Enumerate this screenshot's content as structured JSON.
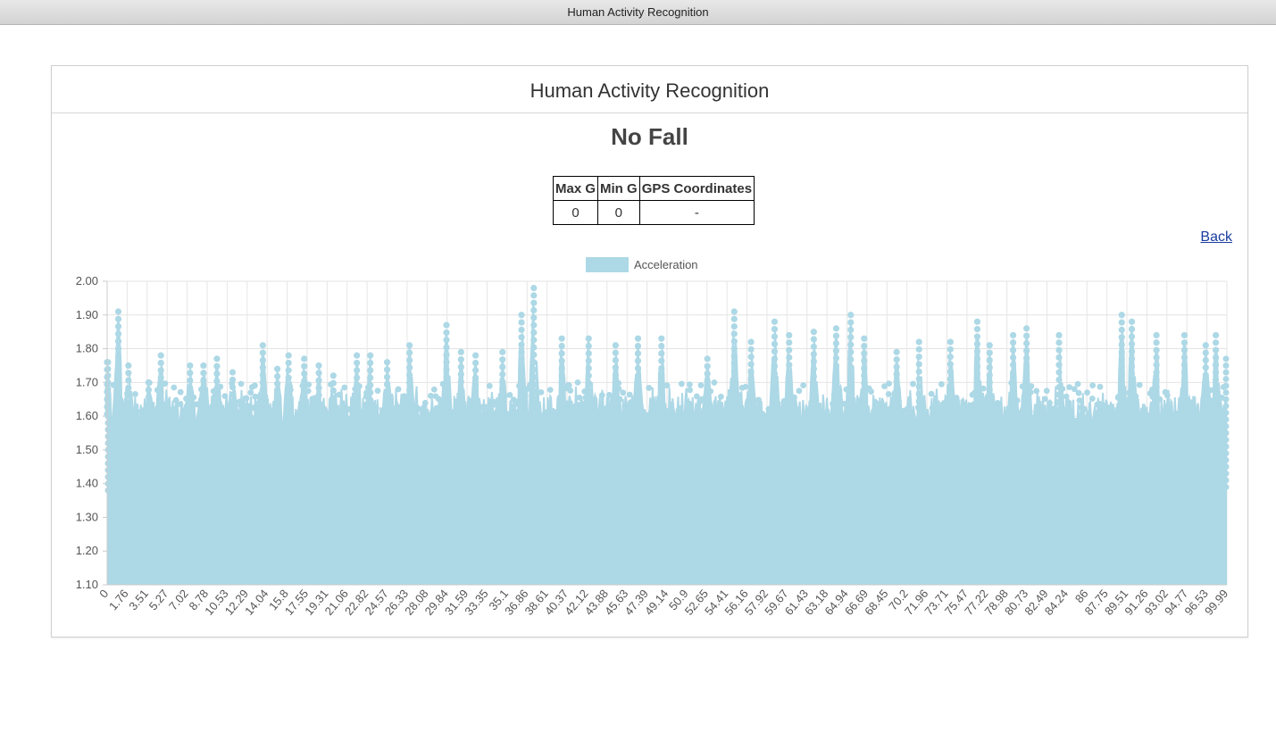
{
  "window": {
    "title": "Human Activity Recognition"
  },
  "card": {
    "title": "Human Activity Recognition"
  },
  "status": "No Fall",
  "stats_table": {
    "headers": [
      "Max G",
      "Min G",
      "GPS Coordinates"
    ],
    "row": [
      "0",
      "0",
      "-"
    ]
  },
  "back_link": "Back",
  "chart_data": {
    "type": "area",
    "series": [
      {
        "name": "Acceleration",
        "color": "#add8e6"
      }
    ],
    "ylim": [
      1.1,
      2.0
    ],
    "y_ticks": [
      "2.00",
      "1.90",
      "1.80",
      "1.70",
      "1.60",
      "1.50",
      "1.40",
      "1.30",
      "1.20",
      "1.10"
    ],
    "x_tick_labels": [
      "0",
      "1.76",
      "3.51",
      "5.27",
      "7.02",
      "8.78",
      "10.53",
      "12.29",
      "14.04",
      "15.8",
      "17.55",
      "19.31",
      "21.06",
      "22.82",
      "24.57",
      "26.33",
      "28.08",
      "29.84",
      "31.59",
      "33.35",
      "35.1",
      "36.86",
      "38.61",
      "40.37",
      "42.12",
      "43.88",
      "45.63",
      "47.39",
      "49.14",
      "50.9",
      "52.65",
      "54.41",
      "56.16",
      "57.92",
      "59.67",
      "61.43",
      "63.18",
      "64.94",
      "66.69",
      "68.45",
      "70.2",
      "71.96",
      "73.71",
      "75.47",
      "77.22",
      "78.98",
      "80.73",
      "82.49",
      "84.24",
      "86",
      "87.75",
      "89.51",
      "91.26",
      "93.02",
      "94.77",
      "96.53",
      "99.99"
    ],
    "x_range": [
      0,
      99.99
    ],
    "grid": true,
    "legend": "top-center",
    "notes_peaks": [
      {
        "x": 0.0,
        "y": 1.76
      },
      {
        "x": 1.0,
        "y": 1.91
      },
      {
        "x": 1.9,
        "y": 1.75
      },
      {
        "x": 3.7,
        "y": 1.7
      },
      {
        "x": 4.8,
        "y": 1.78
      },
      {
        "x": 7.4,
        "y": 1.75
      },
      {
        "x": 8.6,
        "y": 1.75
      },
      {
        "x": 9.8,
        "y": 1.77
      },
      {
        "x": 11.2,
        "y": 1.73
      },
      {
        "x": 13.9,
        "y": 1.81
      },
      {
        "x": 15.2,
        "y": 1.74
      },
      {
        "x": 16.2,
        "y": 1.78
      },
      {
        "x": 17.6,
        "y": 1.77
      },
      {
        "x": 18.9,
        "y": 1.75
      },
      {
        "x": 20.2,
        "y": 1.72
      },
      {
        "x": 22.3,
        "y": 1.78
      },
      {
        "x": 23.5,
        "y": 1.78
      },
      {
        "x": 25.0,
        "y": 1.76
      },
      {
        "x": 27.0,
        "y": 1.81
      },
      {
        "x": 30.3,
        "y": 1.87
      },
      {
        "x": 31.6,
        "y": 1.79
      },
      {
        "x": 32.9,
        "y": 1.78
      },
      {
        "x": 35.3,
        "y": 1.79
      },
      {
        "x": 37.0,
        "y": 1.9
      },
      {
        "x": 38.1,
        "y": 1.98
      },
      {
        "x": 40.6,
        "y": 1.83
      },
      {
        "x": 43.0,
        "y": 1.83
      },
      {
        "x": 45.4,
        "y": 1.81
      },
      {
        "x": 47.4,
        "y": 1.83
      },
      {
        "x": 49.5,
        "y": 1.83
      },
      {
        "x": 53.6,
        "y": 1.77
      },
      {
        "x": 56.0,
        "y": 1.91
      },
      {
        "x": 57.5,
        "y": 1.82
      },
      {
        "x": 59.6,
        "y": 1.88
      },
      {
        "x": 60.9,
        "y": 1.84
      },
      {
        "x": 63.1,
        "y": 1.85
      },
      {
        "x": 65.1,
        "y": 1.86
      },
      {
        "x": 66.4,
        "y": 1.9
      },
      {
        "x": 67.6,
        "y": 1.83
      },
      {
        "x": 70.5,
        "y": 1.79
      },
      {
        "x": 72.5,
        "y": 1.82
      },
      {
        "x": 75.3,
        "y": 1.82
      },
      {
        "x": 77.7,
        "y": 1.88
      },
      {
        "x": 78.8,
        "y": 1.81
      },
      {
        "x": 80.9,
        "y": 1.84
      },
      {
        "x": 82.1,
        "y": 1.86
      },
      {
        "x": 85.0,
        "y": 1.84
      },
      {
        "x": 90.6,
        "y": 1.9
      },
      {
        "x": 91.5,
        "y": 1.88
      },
      {
        "x": 93.7,
        "y": 1.84
      },
      {
        "x": 96.2,
        "y": 1.84
      },
      {
        "x": 98.1,
        "y": 1.81
      },
      {
        "x": 99.0,
        "y": 1.84
      }
    ]
  }
}
